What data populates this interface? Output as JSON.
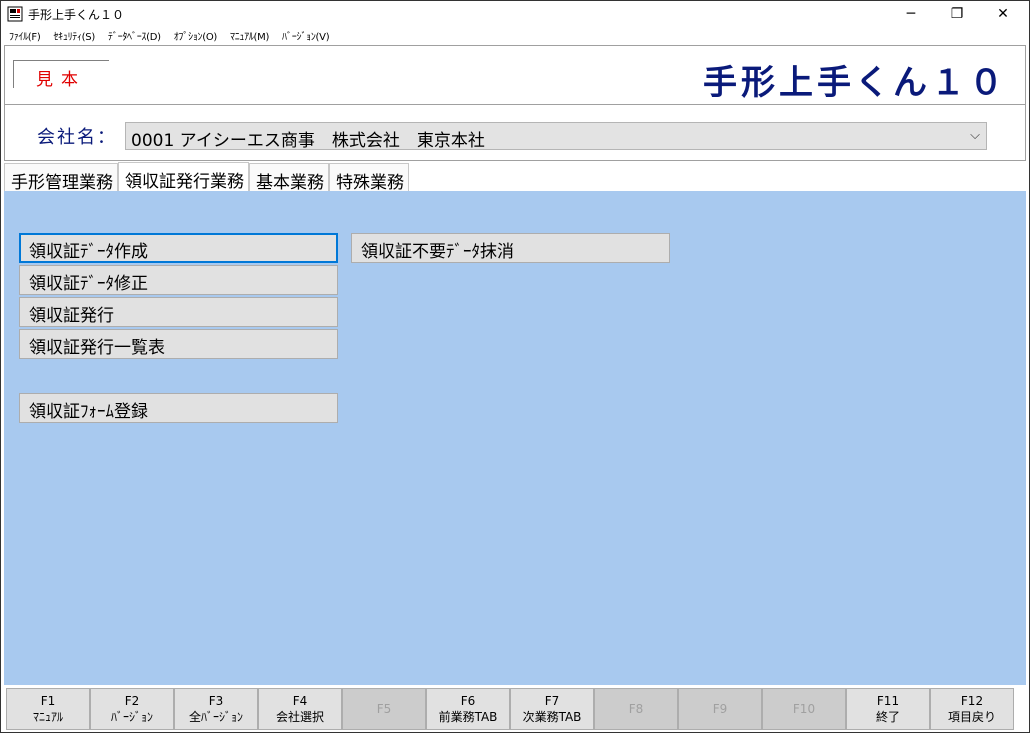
{
  "window": {
    "title": "手形上手くん１０",
    "minimize": "─",
    "restore": "❐",
    "close": "✕"
  },
  "menu": [
    "ﾌｧｲﾙ(F)",
    "ｾｷｭﾘﾃｨ(S)",
    "ﾃﾞｰﾀﾍﾞｰｽ(D)",
    "ｵﾌﾟｼｮﾝ(O)",
    "ﾏﾆｭｱﾙ(M)",
    "ﾊﾞｰｼﾞｮﾝ(V)"
  ],
  "header": {
    "sample_label": "見本",
    "app_title": "手形上手くん１０"
  },
  "company": {
    "label": "会社名：",
    "selected": "0001 アイシーエス商事　株式会社　東京本社"
  },
  "tabs": [
    {
      "label": "手形管理業務",
      "active": false
    },
    {
      "label": "領収証発行業務",
      "active": true
    },
    {
      "label": "基本業務",
      "active": false
    },
    {
      "label": "特殊業務",
      "active": false
    }
  ],
  "actions": {
    "create": "領収証ﾃﾞｰﾀ作成",
    "edit": "領収証ﾃﾞｰﾀ修正",
    "issue": "領収証発行",
    "issue_list": "領収証発行一覧表",
    "form_register": "領収証ﾌｫｰﾑ登録",
    "purge": "領収証不要ﾃﾞｰﾀ抹消"
  },
  "fkeys": [
    {
      "key": "F1",
      "label": "ﾏﾆｭｱﾙ",
      "enabled": true
    },
    {
      "key": "F2",
      "label": "ﾊﾞｰｼﾞｮﾝ",
      "enabled": true
    },
    {
      "key": "F3",
      "label": "全ﾊﾞｰｼﾞｮﾝ",
      "enabled": true
    },
    {
      "key": "F4",
      "label": "会社選択",
      "enabled": true
    },
    {
      "key": "F5",
      "label": "",
      "enabled": false
    },
    {
      "key": "F6",
      "label": "前業務TAB",
      "enabled": true
    },
    {
      "key": "F7",
      "label": "次業務TAB",
      "enabled": true
    },
    {
      "key": "F8",
      "label": "",
      "enabled": false
    },
    {
      "key": "F9",
      "label": "",
      "enabled": false
    },
    {
      "key": "F10",
      "label": "",
      "enabled": false
    },
    {
      "key": "F11",
      "label": "終了",
      "enabled": true
    },
    {
      "key": "F12",
      "label": "項目戻り",
      "enabled": true
    }
  ],
  "colors": {
    "panel_bg": "#a8c9ef",
    "title_navy": "#0a1a7a",
    "sample_red": "#e00000",
    "focus_blue": "#0078d7"
  }
}
